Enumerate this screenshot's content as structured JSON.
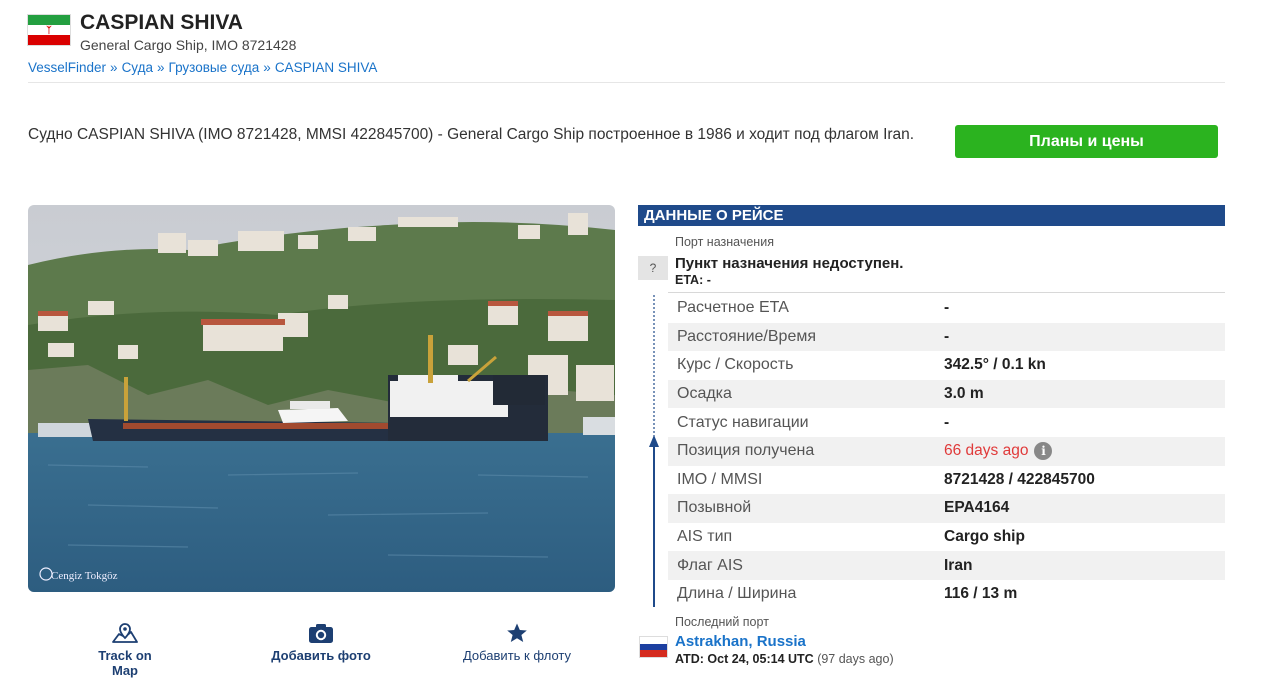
{
  "vessel": {
    "name": "CASPIAN SHIVA",
    "subtitle": "General Cargo Ship, IMO 8721428",
    "flag_colors": [
      "#239f40",
      "#ffffff",
      "#da0000"
    ]
  },
  "breadcrumb": [
    "VesselFinder",
    "Суда",
    "Грузовые суда",
    "CASPIAN SHIVA"
  ],
  "breadcrumb_sep": "»",
  "description": "Судно CASPIAN SHIVA (IMO 8721428, MMSI 422845700) - General Cargo Ship построенное в 1986 и ходит под флагом Iran.",
  "plans_button": "Планы и цены",
  "photo": {
    "credit": "Cengiz Tokgöz"
  },
  "actions": [
    {
      "label": "Track on Map",
      "icon": "map-pin-icon"
    },
    {
      "label": "Добавить фото",
      "icon": "camera-icon"
    },
    {
      "label": "Добавить к флоту",
      "icon": "star-icon"
    }
  ],
  "voyage": {
    "header": "ДАННЫЕ О РЕЙСЕ",
    "destination_label": "Порт назначения",
    "destination_unknown_badge": "?",
    "destination_value": "Пункт назначения недоступен.",
    "eta_line": "ETA: -",
    "rows": [
      {
        "key": "Расчетное ETA",
        "value": "-"
      },
      {
        "key": "Расстояние/Время",
        "value": "-"
      },
      {
        "key": "Курс / Скорость",
        "value": "342.5° / 0.1 kn"
      },
      {
        "key": "Осадка",
        "value": "3.0 m"
      },
      {
        "key": "Статус навигации",
        "value": "-"
      },
      {
        "key": "Позиция получена",
        "value": "66 days ago"
      },
      {
        "key": "IMO / MMSI",
        "value": "8721428 / 422845700"
      },
      {
        "key": "Позывной",
        "value": "EPA4164"
      },
      {
        "key": "AIS тип",
        "value": "Cargo ship"
      },
      {
        "key": "Флаг AIS",
        "value": "Iran"
      },
      {
        "key": "Длина / Ширина",
        "value": "116 / 13 m"
      }
    ],
    "position_info_icon": "i",
    "last_port_label": "Последний порт",
    "last_port": "Astrakhan, Russia",
    "last_port_flag_colors": [
      "#ffffff",
      "#1c3fa0",
      "#d52b1e"
    ],
    "atd": "ATD: Oct 24, 05:14 UTC",
    "atd_relative": "(97 days ago)"
  }
}
